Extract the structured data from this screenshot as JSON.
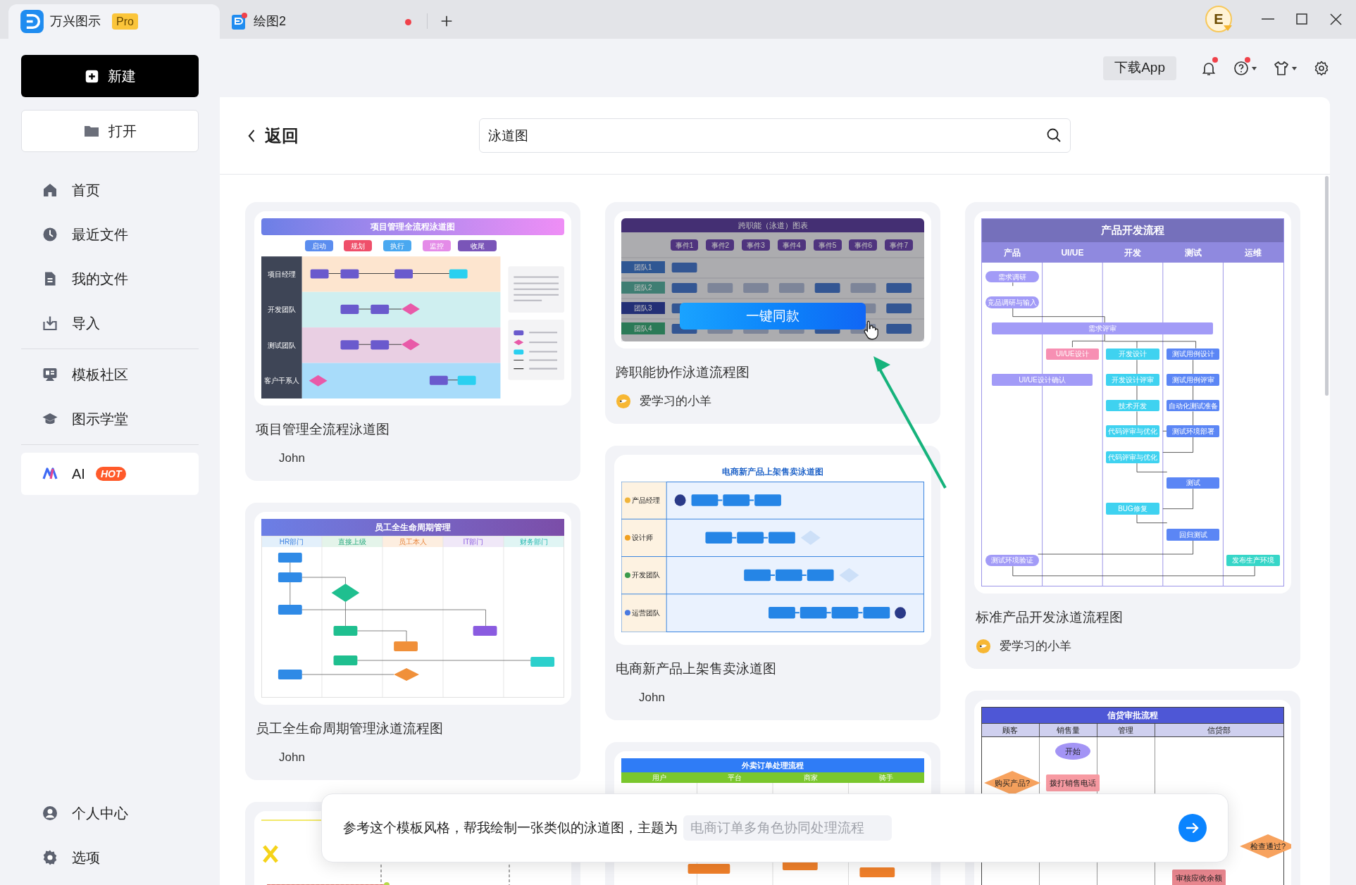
{
  "tabs": [
    {
      "label": "万兴图示",
      "badge": "Pro",
      "selected": true,
      "unsaved": false
    },
    {
      "label": "绘图2",
      "selected": false,
      "unsaved": true
    }
  ],
  "account": {
    "initial": "E"
  },
  "sidebar": {
    "new_button": "新建",
    "open_button": "打开",
    "groups": [
      [
        {
          "kind": "home",
          "label": "首页",
          "selected": false
        },
        {
          "kind": "recent",
          "label": "最近文件",
          "selected": false
        },
        {
          "kind": "files",
          "label": "我的文件",
          "selected": false
        },
        {
          "kind": "import",
          "label": "导入",
          "selected": false
        }
      ],
      [
        {
          "kind": "community",
          "label": "模板社区",
          "selected": false
        },
        {
          "kind": "academy",
          "label": "图示学堂",
          "selected": false
        }
      ],
      [
        {
          "kind": "ai",
          "label": "AI",
          "badge": "HOT",
          "selected": true
        }
      ]
    ],
    "bottom": [
      {
        "kind": "profile",
        "label": "个人中心",
        "selected": false
      },
      {
        "kind": "options",
        "label": "选项",
        "selected": false
      }
    ]
  },
  "toolbar": {
    "download": "下载App",
    "notifications_dot": true,
    "help_dot": true
  },
  "header": {
    "back": "返回",
    "search": "泳道图"
  },
  "columns": [
    [
      {
        "title": "项目管理全流程泳道图",
        "author": "John",
        "author_avatar": false,
        "hovered": false,
        "thumbnail": {
          "kind": "project",
          "title": "项目管理全流程泳道图",
          "columns": [
            {
              "label": "启动",
              "color": "#5b8def"
            },
            {
              "label": "规划",
              "color": "#ef4f6a"
            },
            {
              "label": "执行",
              "color": "#4aa8f0"
            },
            {
              "label": "监控",
              "color": "#e48be8"
            },
            {
              "label": "收尾",
              "color": "#7a55b8"
            }
          ],
          "rows": [
            "项目经理",
            "开发团队",
            "测试团队",
            "客户干系人"
          ]
        }
      },
      {
        "title": "员工全生命周期管理泳道流程图",
        "author": "John",
        "author_avatar": false,
        "hovered": false,
        "thumbnail": {
          "kind": "employee",
          "title": "员工全生命周期管理",
          "columns": [
            "HR部门",
            "直接上级",
            "员工本人",
            "IT部门",
            "财务部门"
          ]
        }
      },
      {
        "hovered": false,
        "thumbnail": {
          "kind": "sketch"
        }
      }
    ],
    [
      {
        "title": "跨职能协作泳道流程图",
        "author": "爱学习的小羊",
        "author_avatar": true,
        "hovered": true,
        "hover_action": "一键同款",
        "thumbnail": {
          "kind": "crossfunc",
          "title": "跨职能（泳道）图表",
          "columns": [
            "事件1",
            "事件2",
            "事件3",
            "事件4",
            "事件5",
            "事件6",
            "事件7"
          ],
          "rows": [
            "团队1",
            "团队2",
            "团队3",
            "团队4"
          ]
        }
      },
      {
        "title": "电商新产品上架售卖泳道图",
        "author": "John",
        "author_avatar": false,
        "hovered": false,
        "thumbnail": {
          "kind": "ecommerce",
          "title": "电商新产品上架售卖泳道图",
          "rows": [
            "产品经理",
            "设计师",
            "开发团队",
            "运营团队"
          ]
        }
      },
      {
        "hovered": false,
        "thumbnail": {
          "kind": "delivery",
          "title": "外卖订单处理流程",
          "columns": [
            "用户",
            "平台",
            "商家",
            "骑手"
          ]
        }
      }
    ],
    [
      {
        "title": "标准产品开发泳道流程图",
        "author": "爱学习的小羊",
        "author_avatar": true,
        "hovered": false,
        "thumbnail": {
          "kind": "product",
          "title": "产品开发流程",
          "columns": [
            "产品",
            "UI/UE",
            "开发",
            "测试",
            "运维"
          ],
          "nodes": [
            {
              "label": "需求调研",
              "color": "#a29bf7"
            },
            {
              "label": "竞品调研与输入",
              "color": "#a29bf7"
            },
            {
              "label": "需求评审",
              "color": "#a29bf7"
            },
            {
              "label": "UI/UE设计",
              "color": "#f78fb3"
            },
            {
              "label": "开发设计",
              "color": "#3fd2f0"
            },
            {
              "label": "测试用例设计",
              "color": "#5b86f5"
            },
            {
              "label": "UI/UE设计确认",
              "color": "#a29bf7"
            },
            {
              "label": "开发设计评审",
              "color": "#3fd2f0"
            },
            {
              "label": "测试用例评审",
              "color": "#5b86f5"
            },
            {
              "label": "技术开发",
              "color": "#3fd2f0"
            },
            {
              "label": "自动化测试准备",
              "color": "#5b86f5"
            },
            {
              "label": "代码评审与优化",
              "color": "#3fd2f0"
            },
            {
              "label": "测试环境部署",
              "color": "#5b86f5"
            },
            {
              "label": "代码评审与优化",
              "color": "#3fd2f0"
            },
            {
              "label": "测试",
              "color": "#5b86f5"
            },
            {
              "label": "BUG修复",
              "color": "#3fd2f0"
            },
            {
              "label": "回归测试",
              "color": "#5b86f5"
            },
            {
              "label": "测试环境验证",
              "color": "#a29bf7"
            },
            {
              "label": "发布生产环境",
              "color": "#36d6c8"
            }
          ]
        }
      },
      {
        "hovered": false,
        "thumbnail": {
          "kind": "credit",
          "title": "信贷审批流程",
          "columns": [
            "顾客",
            "销售量",
            "管理",
            "信贷部"
          ],
          "nodes": [
            {
              "label": "开始",
              "color": "#a394f5"
            },
            {
              "label": "购买产品?",
              "color": "#f7a25e"
            },
            {
              "label": "拨打销售电话",
              "color": "#f79aa2"
            },
            {
              "label": "检查通过?",
              "color": "#f7a25e"
            },
            {
              "label": "审核应收余额",
              "color": "#e8868e"
            }
          ]
        }
      }
    ]
  ],
  "prompt": {
    "text": "参考这个模板风格，帮我绘制一张类似的泳道图，主题为",
    "placeholder": "电商订单多角色协同处理流程"
  }
}
